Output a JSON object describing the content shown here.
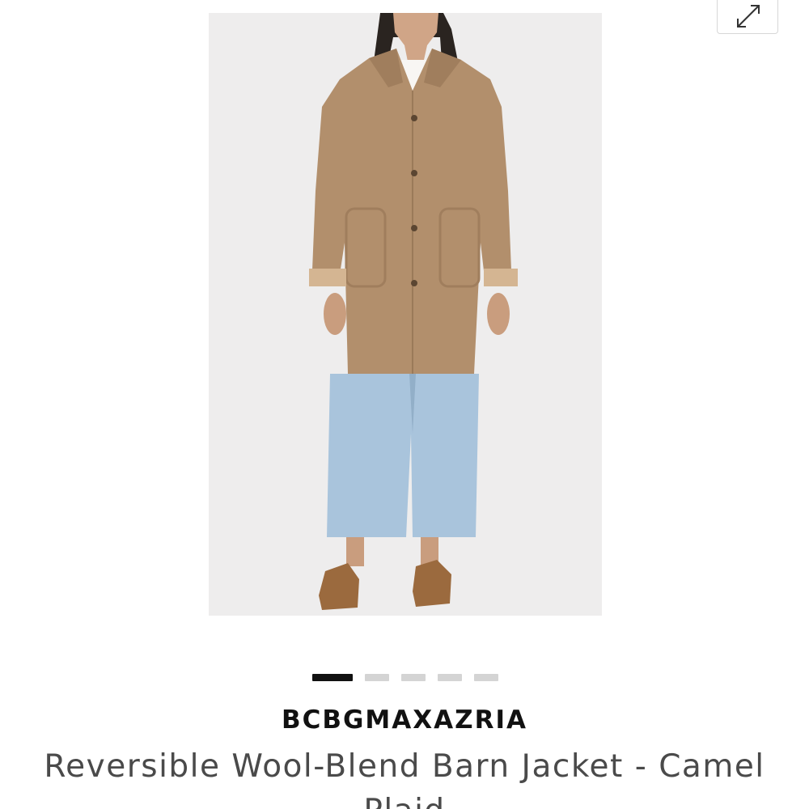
{
  "gallery": {
    "expand_icon": "expand-arrows-icon",
    "image_alt": "Model wearing camel wool-blend barn jacket with light wash jeans and brown suede loafers",
    "slide_count": 5,
    "active_slide": 1
  },
  "product": {
    "brand": "BCBGMAXAZRIA",
    "title": "Reversible Wool-Blend Barn Jacket - Camel Plaid"
  },
  "colors": {
    "coat": "#b28f6c",
    "jeans": "#a9c4dc",
    "shoes": "#9b6a3e",
    "background": "#eeeded",
    "active_dot": "#111111",
    "inactive_dot": "#d4d4d4"
  }
}
